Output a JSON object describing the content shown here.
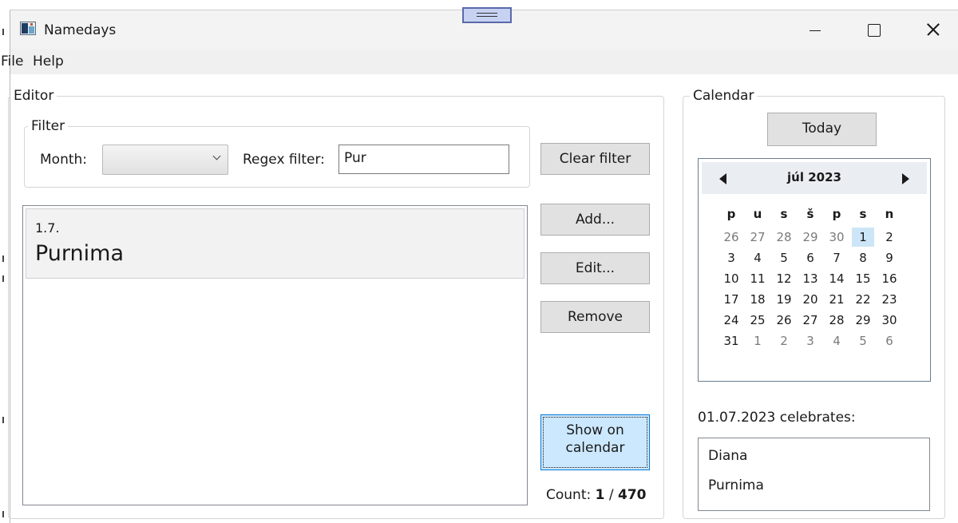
{
  "window": {
    "title": "Namedays"
  },
  "menu": [
    {
      "label": "File"
    },
    {
      "label": "Help"
    }
  ],
  "editor": {
    "legend": "Editor",
    "filter": {
      "legend": "Filter",
      "month_label": "Month:",
      "month_value": "",
      "regex_label": "Regex filter:",
      "regex_value": "Pur"
    },
    "buttons": {
      "clear_filter": "Clear filter",
      "add": "Add...",
      "edit": "Edit...",
      "remove": "Remove",
      "show_line1": "Show on",
      "show_line2": "calendar"
    },
    "list": [
      {
        "date": "1.7.",
        "name": "Purnima"
      }
    ],
    "count": {
      "label": "Count:",
      "shown": "1",
      "sep": "/",
      "total": "470"
    }
  },
  "calendar": {
    "legend": "Calendar",
    "today_label": "Today",
    "month_title": "júl 2023",
    "weekdays": [
      "p",
      "u",
      "s",
      "š",
      "p",
      "s",
      "n"
    ],
    "weeks": [
      [
        "26",
        "27",
        "28",
        "29",
        "30",
        "1",
        "2"
      ],
      [
        "3",
        "4",
        "5",
        "6",
        "7",
        "8",
        "9"
      ],
      [
        "10",
        "11",
        "12",
        "13",
        "14",
        "15",
        "16"
      ],
      [
        "17",
        "18",
        "19",
        "20",
        "21",
        "22",
        "23"
      ],
      [
        "24",
        "25",
        "26",
        "27",
        "28",
        "29",
        "30"
      ],
      [
        "31",
        "1",
        "2",
        "3",
        "4",
        "5",
        "6"
      ]
    ],
    "selected_day": "1",
    "celebrates_label": "01.07.2023 celebrates:",
    "celebrants": [
      "Diana",
      "Purnima"
    ]
  },
  "colors": {
    "selected_day_bg": "#cde6f7",
    "focused_button_bg": "#cce8ff",
    "title_bar": "#f3f3f3"
  }
}
